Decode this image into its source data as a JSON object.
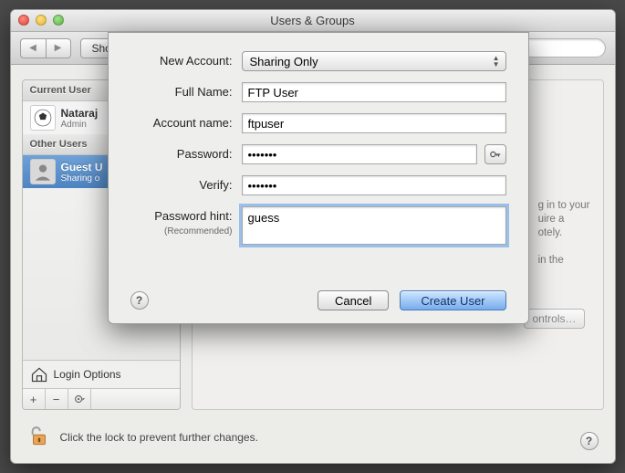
{
  "window": {
    "title": "Users & Groups"
  },
  "toolbar": {
    "show_all": "Show All",
    "search_placeholder": ""
  },
  "sidebar": {
    "sections": {
      "current": "Current User",
      "other": "Other Users"
    },
    "items": [
      {
        "name": "Nataraj",
        "sub": "Admin"
      },
      {
        "name": "Guest U",
        "sub": "Sharing o"
      }
    ],
    "login_options": "Login Options"
  },
  "ghost": {
    "controls_btn": "ontrols…",
    "side_text1": "g in to your",
    "side_text2": "uire a",
    "side_text3": "otely.",
    "side_text4": "in the"
  },
  "sheet": {
    "labels": {
      "new_account": "New Account:",
      "full_name": "Full Name:",
      "account_name": "Account name:",
      "password": "Password:",
      "verify": "Verify:",
      "hint": "Password hint:",
      "hint_sub": "(Recommended)"
    },
    "values": {
      "new_account": "Sharing Only",
      "full_name": "FTP User",
      "account_name": "ftpuser",
      "password": "•••••••",
      "verify": "•••••••",
      "hint": "guess"
    },
    "buttons": {
      "cancel": "Cancel",
      "create": "Create User"
    }
  },
  "lock_text": "Click the lock to prevent further changes."
}
